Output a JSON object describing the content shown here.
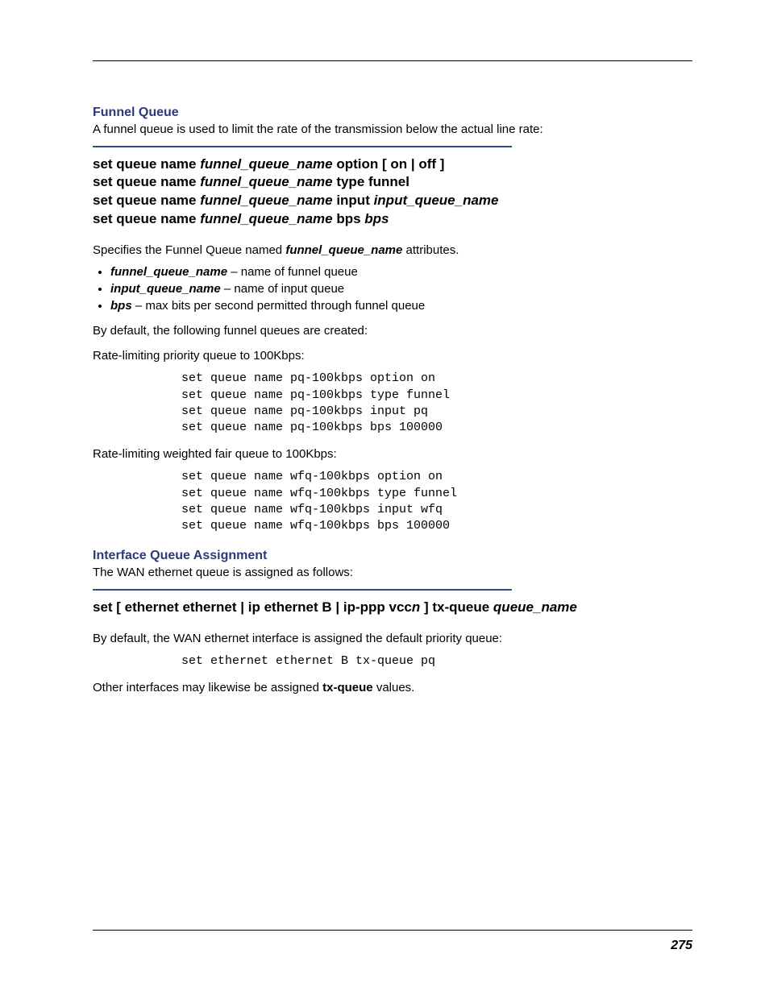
{
  "section1": {
    "heading": "Funnel Queue",
    "intro": "A funnel queue is used to limit the rate of the transmission below the actual line rate:",
    "cmd": {
      "l1a": "set queue name ",
      "l1b": "funnel_queue_name",
      "l1c": " option [ on | off ]",
      "l2a": "set queue name ",
      "l2b": "funnel_queue_name",
      "l2c": " type funnel",
      "l3a": "set queue name ",
      "l3b": "funnel_queue_name",
      "l3c": " input ",
      "l3d": "input_queue_name",
      "l4a": "set queue name ",
      "l4b": "funnel_queue_name",
      "l4c": " bps ",
      "l4d": "bps"
    },
    "spec_a": "Specifies the Funnel Queue named ",
    "spec_b": "funnel_queue_name",
    "spec_c": " attributes.",
    "bullets": [
      {
        "term": "funnel_queue_name",
        "desc": " – name of funnel queue"
      },
      {
        "term": "input_queue_name",
        "desc": " – name of input queue"
      },
      {
        "term": "bps",
        "desc": " – max bits per second permitted through funnel queue"
      }
    ],
    "default_text": "By default, the following funnel queues are created:",
    "rate1_label": "Rate-limiting priority queue to 100Kbps:",
    "rate1_code": "set queue name pq-100kbps option on\nset queue name pq-100kbps type funnel\nset queue name pq-100kbps input pq\nset queue name pq-100kbps bps 100000",
    "rate2_label": "Rate-limiting weighted fair queue to 100Kbps:",
    "rate2_code": "set queue name wfq-100kbps option on\nset queue name wfq-100kbps type funnel\nset queue name wfq-100kbps input wfq\nset queue name wfq-100kbps bps 100000"
  },
  "section2": {
    "heading": "Interface Queue Assignment",
    "intro": "The WAN ethernet queue is assigned as follows:",
    "cmd": {
      "a": "set [ ethernet ethernet | ip ethernet B | ip-ppp vcc",
      "b": "n",
      "c": " ] tx-queue ",
      "d": "queue_name"
    },
    "default_text": "By default, the WAN ethernet interface is assigned the default priority queue:",
    "code": "set ethernet ethernet B tx-queue pq",
    "other_a": "Other interfaces may likewise be assigned ",
    "other_b": "tx-queue",
    "other_c": " values."
  },
  "page_number": "275"
}
